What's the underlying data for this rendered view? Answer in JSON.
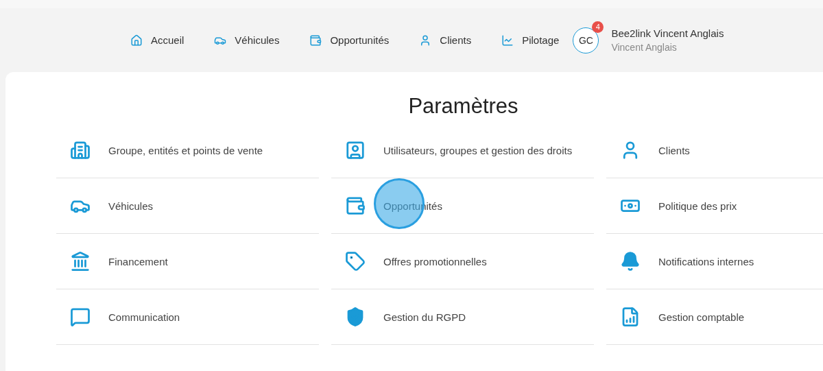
{
  "nav": {
    "items": [
      {
        "label": "Accueil"
      },
      {
        "label": "Véhicules"
      },
      {
        "label": "Opportunités"
      },
      {
        "label": "Clients"
      },
      {
        "label": "Pilotage"
      }
    ],
    "user": {
      "initials": "GC",
      "badge": "4",
      "name": "Bee2link Vincent Anglais",
      "subtitle": "Vincent Anglais"
    }
  },
  "settings": {
    "title": "Paramètres",
    "items": [
      {
        "label": "Groupe, entités et points de vente",
        "clicked": false
      },
      {
        "label": "Utilisateurs, groupes et gestion des droits",
        "clicked": false
      },
      {
        "label": "Clients",
        "clicked": false
      },
      {
        "label": "Véhicules",
        "clicked": false
      },
      {
        "label": "Opportunités",
        "clicked": true
      },
      {
        "label": "Politique des prix",
        "clicked": false
      },
      {
        "label": "Financement",
        "clicked": false
      },
      {
        "label": "Offres promotionnelles",
        "clicked": false
      },
      {
        "label": "Notifications internes",
        "clicked": false
      },
      {
        "label": "Communication",
        "clicked": false
      },
      {
        "label": "Gestion du RGPD",
        "clicked": false
      },
      {
        "label": "Gestion comptable",
        "clicked": false
      }
    ]
  }
}
